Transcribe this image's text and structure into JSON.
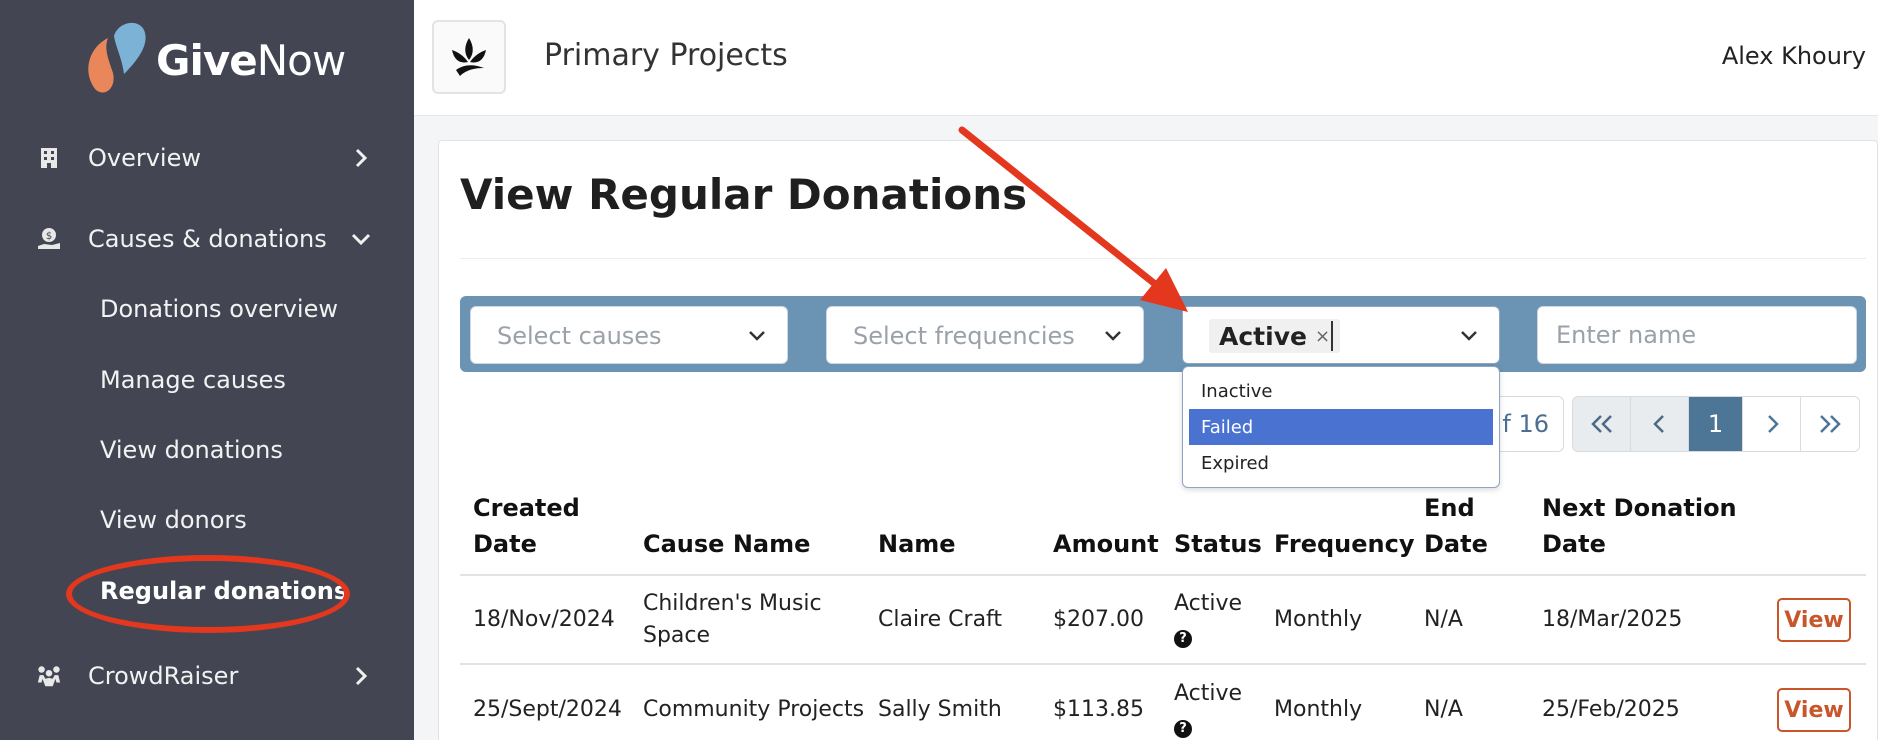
{
  "app": {
    "logo_bold": "Give",
    "logo_light": "Now"
  },
  "sidebar": {
    "items": [
      {
        "label": "Overview"
      },
      {
        "label": "Causes & donations"
      },
      {
        "label": "CrowdRaiser"
      }
    ],
    "sub_items": [
      {
        "label": "Donations overview"
      },
      {
        "label": "Manage causes"
      },
      {
        "label": "View donations"
      },
      {
        "label": "View donors"
      },
      {
        "label": "Regular donations"
      }
    ]
  },
  "header": {
    "org_title": "Primary Projects",
    "user_name": "Alex Khoury"
  },
  "main": {
    "title": "View Regular Donations",
    "filters": {
      "causes_placeholder": "Select causes",
      "frequencies_placeholder": "Select frequencies",
      "status_chip": "Active",
      "status_chip_remove": "×",
      "name_placeholder": "Enter name"
    },
    "status_dropdown": {
      "options": [
        "Inactive",
        "Failed",
        "Expired"
      ],
      "highlighted": "Failed"
    },
    "pagination": {
      "page_info": "f 16",
      "current_page": "1"
    },
    "table": {
      "headers": [
        "Created Date",
        "Cause Name",
        "Name",
        "Amount",
        "Status",
        "Frequency",
        "End Date",
        "Next Donation Date"
      ],
      "header_lines": [
        [
          "Created",
          "Date"
        ],
        [
          "Cause Name"
        ],
        [
          "Name"
        ],
        [
          "Amount"
        ],
        [
          "Status"
        ],
        [
          "Frequency"
        ],
        [
          "End",
          "Date"
        ],
        [
          "Next Donation",
          "Date"
        ]
      ],
      "rows": [
        {
          "created": "18/Nov/2024",
          "cause": "Children's Music Space",
          "cause_l1": "Children's Music",
          "cause_l2": "Space",
          "name": "Claire Craft",
          "amount": "$207.00",
          "status": "Active",
          "frequency": "Monthly",
          "end": "N/A",
          "next": "18/Mar/2025",
          "action": "View"
        },
        {
          "created": "25/Sept/2024",
          "cause": "Community Projects",
          "cause_l1": "Community Projects",
          "cause_l2": "",
          "name": "Sally Smith",
          "amount": "$113.85",
          "status": "Active",
          "frequency": "Monthly",
          "end": "N/A",
          "next": "25/Feb/2025",
          "action": "View"
        }
      ],
      "status_help_glyph": "?"
    }
  },
  "colors": {
    "sidebar_bg": "#434652",
    "filter_bar": "#6a93b4",
    "annotation_red": "#e3371e",
    "dropdown_highlight": "#4a72d0",
    "view_button": "#c8562a",
    "pager_current": "#4d7596"
  },
  "icons": {
    "overview": "building-icon",
    "causes": "hand-coin-icon",
    "crowdraiser": "people-icon"
  }
}
